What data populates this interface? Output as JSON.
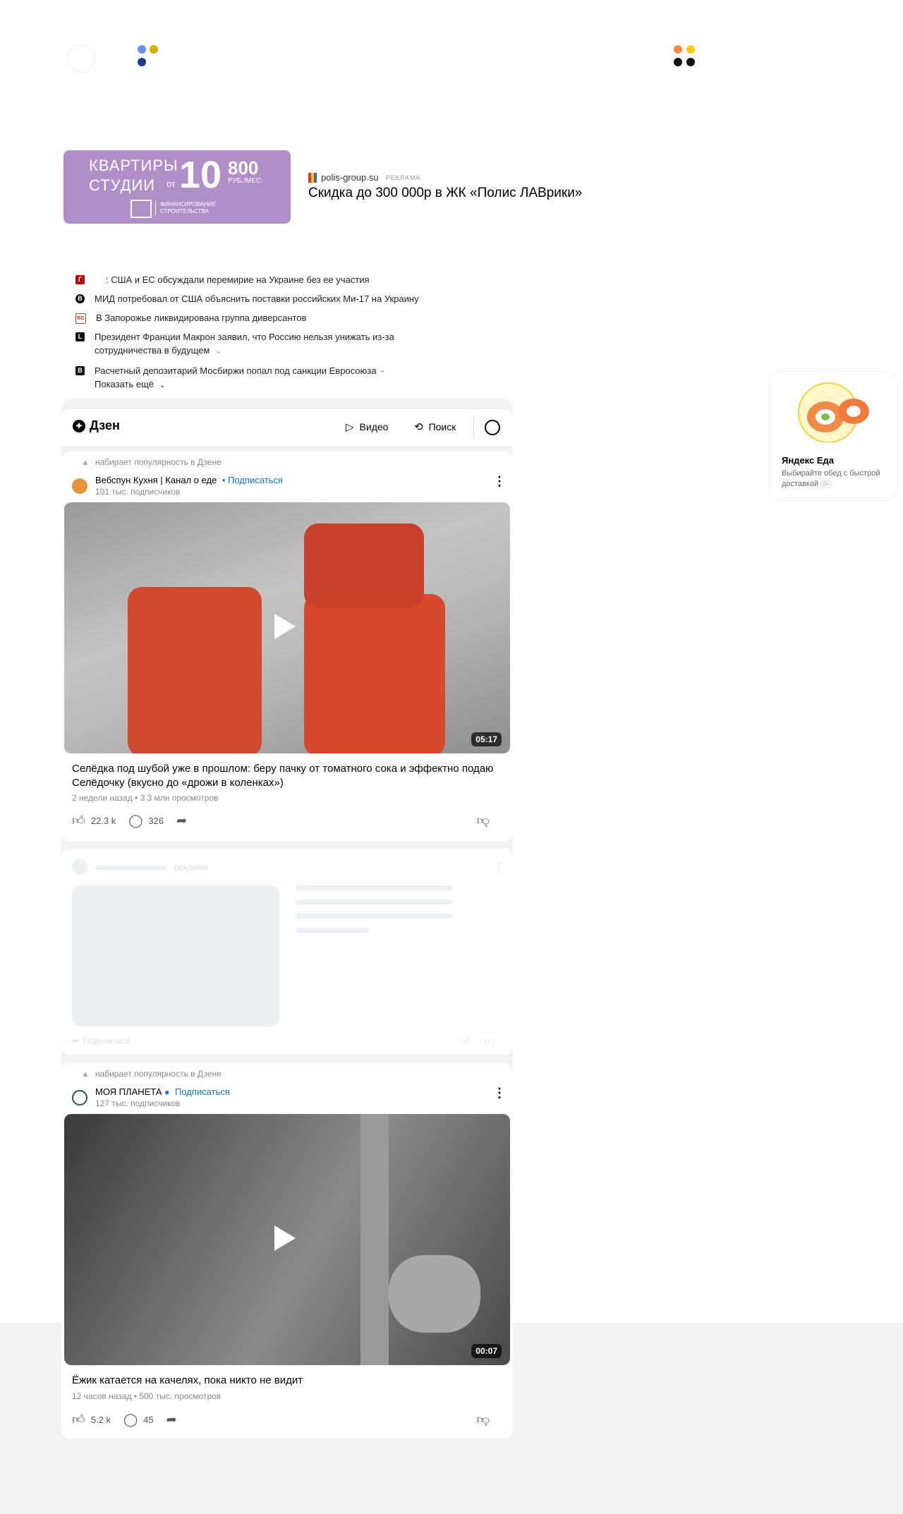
{
  "ad": {
    "banner_line1": "КВАРТИРЫ",
    "banner_line2": "СТУДИИ",
    "banner_from": "от",
    "banner_price_big": "10",
    "banner_price_small": "800",
    "banner_unit": "РУБ./МЕС.",
    "banner_financing": "ФИНАНСИРОВАНИЕ СТРОИТЕЛЬСТВА",
    "source": "polis-group.su",
    "source_label": "РЕКЛАМА",
    "title": "Скидка до 300 000р в ЖК «Полис ЛАВрики»"
  },
  "news": {
    "items": [
      {
        "text": ": США и ЕС обсуждали перемирие на Украине без ее участия",
        "icon_color": "#c00000",
        "icon": "Г"
      },
      {
        "text": "МИД потребовал от США объяснить поставки российских Ми-17 на Украину",
        "icon_color": "#111111",
        "icon": "В"
      },
      {
        "text": "В Запорожье ликвидирована группа диверсантов",
        "icon_color": "#c0392b",
        "icon": "RG"
      },
      {
        "text": "Президент Франции Макрон заявил, что Россию нельзя унижать из-за сотрудничества в будущем",
        "icon_color": "#111111",
        "icon": "L"
      },
      {
        "text": "Расчетный депозитарий Мосбиржи попал под санкции Евросоюза",
        "icon_color": "#111111",
        "icon": "В"
      }
    ],
    "show_more": "Показать ещё"
  },
  "zen": {
    "logo": "Дзен",
    "nav_video": "Видео",
    "nav_search": "Поиск",
    "posts": [
      {
        "popular": "набирает популярность в Дзене",
        "channel": "Вебспун Кухня | Канал о еде",
        "subscribe": "• Подписаться",
        "subscribers": "101 тыс. подписчиков",
        "duration": "05:17",
        "title": "Селёдка под шубой уже в прошлом: беру пачку от томатного сока и эффектно подаю Селёдочку (вкусно до «дрожи в коленках»)",
        "meta": "2 недели назад • 3.3 млн просмотров",
        "likes": "22.3 k",
        "comments": "326"
      },
      {
        "popular": "набирает популярность в Дзене",
        "channel": "МОЯ ПЛАНЕТА",
        "subscribe": "Подписаться",
        "subscribers": "127 тыс. подписчиков",
        "duration": "00:07",
        "title": "Ёжик катается на качелях, пока никто не видит",
        "meta": "12 часов назад • 500 тыс. просмотров",
        "likes": "5.2 k",
        "comments": "45"
      }
    ],
    "skeleton": {
      "ad_label": "реклама",
      "share": "Поделиться"
    }
  },
  "eda": {
    "name": "Яндекс Еда",
    "desc": "Выбирайте обед с быстрой доставкой",
    "age": "0+"
  },
  "colors": {
    "accent_blue": "#0a73eb",
    "ad_purple": "#b08fc9",
    "background_gray": "#f2f2f2"
  }
}
